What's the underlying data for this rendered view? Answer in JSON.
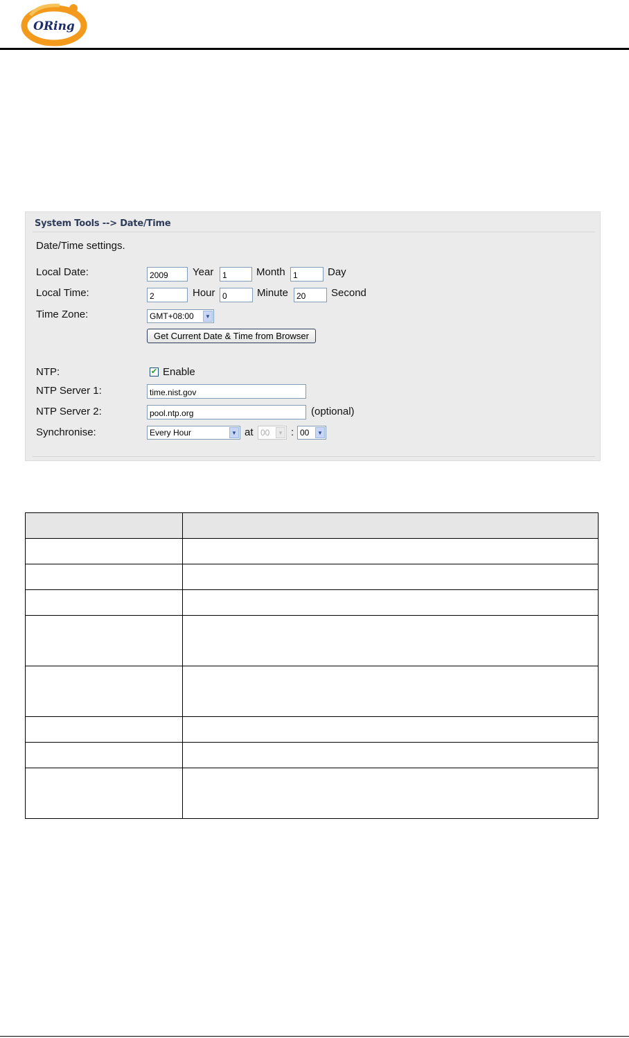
{
  "header": {
    "logo_text": "ORing"
  },
  "panel": {
    "breadcrumb": "System Tools --> Date/Time",
    "section_title": "Date/Time settings.",
    "local_date": {
      "label": "Local Date:",
      "year_value": "2009",
      "year_unit": "Year",
      "month_value": "1",
      "month_unit": "Month",
      "day_value": "1",
      "day_unit": "Day"
    },
    "local_time": {
      "label": "Local Time:",
      "hour_value": "2",
      "hour_unit": "Hour",
      "minute_value": "0",
      "minute_unit": "Minute",
      "second_value": "20",
      "second_unit": "Second"
    },
    "time_zone": {
      "label": "Time Zone:",
      "value": "GMT+08:00"
    },
    "get_time_button": "Get Current Date & Time from Browser",
    "ntp": {
      "label": "NTP:",
      "checkbox_label": "Enable",
      "checked": true
    },
    "ntp_server_1": {
      "label": "NTP Server 1:",
      "value": "time.nist.gov"
    },
    "ntp_server_2": {
      "label": "NTP Server 2:",
      "value": "pool.ntp.org",
      "note": "(optional)"
    },
    "synchronise": {
      "label": "Synchronise:",
      "interval": "Every Hour",
      "at_label": "at",
      "hour": "00",
      "separator": ":",
      "minute": "00"
    }
  },
  "colors": {
    "panel_background": "#ebebeb",
    "breadcrumb": "#2f3d5a",
    "table_header": "#e6e6e6"
  }
}
